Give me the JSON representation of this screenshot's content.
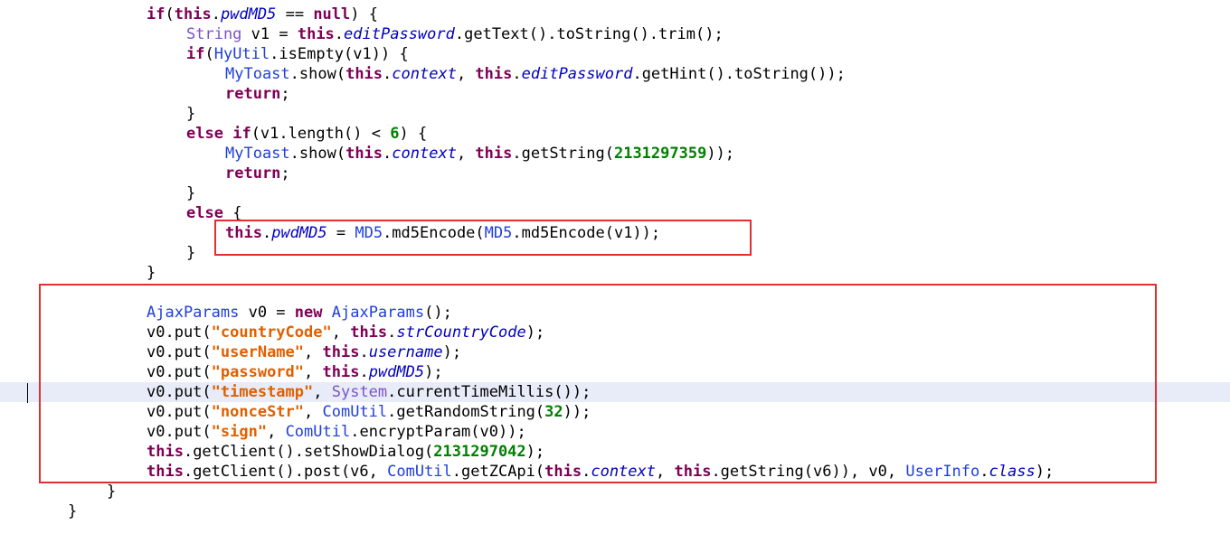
{
  "editor": {
    "lines": [
      [
        {
          "t": "if",
          "c": "kw"
        },
        {
          "t": "("
        },
        {
          "t": "this",
          "c": "kw"
        },
        {
          "t": "."
        },
        {
          "t": "pwdMD5",
          "c": "fld"
        },
        {
          "t": " == "
        },
        {
          "t": "null",
          "c": "kw"
        },
        {
          "t": ") {"
        }
      ],
      [
        {
          "t": "String",
          "c": "iface"
        },
        {
          "t": " v1 = "
        },
        {
          "t": "this",
          "c": "kw"
        },
        {
          "t": "."
        },
        {
          "t": "editPassword",
          "c": "fld"
        },
        {
          "t": ".getText().toString().trim();"
        }
      ],
      [
        {
          "t": "if",
          "c": "kw"
        },
        {
          "t": "("
        },
        {
          "t": "HyUtil",
          "c": "cls"
        },
        {
          "t": ".isEmpty(v1)) {"
        }
      ],
      [
        {
          "t": "MyToast",
          "c": "cls"
        },
        {
          "t": ".show("
        },
        {
          "t": "this",
          "c": "kw"
        },
        {
          "t": "."
        },
        {
          "t": "context",
          "c": "fld"
        },
        {
          "t": ", "
        },
        {
          "t": "this",
          "c": "kw"
        },
        {
          "t": "."
        },
        {
          "t": "editPassword",
          "c": "fld"
        },
        {
          "t": ".getHint().toString());"
        }
      ],
      [
        {
          "t": "return",
          "c": "kw"
        },
        {
          "t": ";"
        }
      ],
      [
        {
          "t": "}"
        }
      ],
      [
        {
          "t": "else",
          "c": "kw"
        },
        {
          "t": " "
        },
        {
          "t": "if",
          "c": "kw"
        },
        {
          "t": "(v1.length() < "
        },
        {
          "t": "6",
          "c": "num"
        },
        {
          "t": ") {"
        }
      ],
      [
        {
          "t": "MyToast",
          "c": "cls"
        },
        {
          "t": ".show("
        },
        {
          "t": "this",
          "c": "kw"
        },
        {
          "t": "."
        },
        {
          "t": "context",
          "c": "fld"
        },
        {
          "t": ", "
        },
        {
          "t": "this",
          "c": "kw"
        },
        {
          "t": ".getString("
        },
        {
          "t": "2131297359",
          "c": "num"
        },
        {
          "t": "));"
        }
      ],
      [
        {
          "t": "return",
          "c": "kw"
        },
        {
          "t": ";"
        }
      ],
      [
        {
          "t": "}"
        }
      ],
      [
        {
          "t": "else",
          "c": "kw"
        },
        {
          "t": " {"
        }
      ],
      [
        {
          "t": "this",
          "c": "kw"
        },
        {
          "t": "."
        },
        {
          "t": "pwdMD5",
          "c": "fld"
        },
        {
          "t": " = "
        },
        {
          "t": "MD5",
          "c": "cls"
        },
        {
          "t": ".md5Encode("
        },
        {
          "t": "MD5",
          "c": "cls"
        },
        {
          "t": ".md5Encode(v1));"
        }
      ],
      [
        {
          "t": "}"
        }
      ],
      [
        {
          "t": "}"
        }
      ],
      [],
      [
        {
          "t": "AjaxParams",
          "c": "cls"
        },
        {
          "t": " v0 = "
        },
        {
          "t": "new",
          "c": "kw"
        },
        {
          "t": " "
        },
        {
          "t": "AjaxParams",
          "c": "cls"
        },
        {
          "t": "();"
        }
      ],
      [
        {
          "t": "v0.put("
        },
        {
          "t": "\"countryCode\"",
          "c": "str"
        },
        {
          "t": ", "
        },
        {
          "t": "this",
          "c": "kw"
        },
        {
          "t": "."
        },
        {
          "t": "strCountryCode",
          "c": "fld"
        },
        {
          "t": ");"
        }
      ],
      [
        {
          "t": "v0.put("
        },
        {
          "t": "\"userName\"",
          "c": "str"
        },
        {
          "t": ", "
        },
        {
          "t": "this",
          "c": "kw"
        },
        {
          "t": "."
        },
        {
          "t": "username",
          "c": "fld"
        },
        {
          "t": ");"
        }
      ],
      [
        {
          "t": "v0.put("
        },
        {
          "t": "\"password\"",
          "c": "str"
        },
        {
          "t": ", "
        },
        {
          "t": "this",
          "c": "kw"
        },
        {
          "t": "."
        },
        {
          "t": "pwdMD5",
          "c": "fld"
        },
        {
          "t": ");"
        }
      ],
      [
        {
          "t": "v0.put("
        },
        {
          "t": "\"timestamp\"",
          "c": "str"
        },
        {
          "t": ", "
        },
        {
          "t": "System",
          "c": "iface"
        },
        {
          "t": ".currentTimeMillis());"
        }
      ],
      [
        {
          "t": "v0.put("
        },
        {
          "t": "\"nonceStr\"",
          "c": "str"
        },
        {
          "t": ", "
        },
        {
          "t": "ComUtil",
          "c": "cls"
        },
        {
          "t": ".getRandomString("
        },
        {
          "t": "32",
          "c": "num"
        },
        {
          "t": "));"
        }
      ],
      [
        {
          "t": "v0.put("
        },
        {
          "t": "\"sign\"",
          "c": "str"
        },
        {
          "t": ", "
        },
        {
          "t": "ComUtil",
          "c": "cls"
        },
        {
          "t": ".encryptParam(v0));"
        }
      ],
      [
        {
          "t": "this",
          "c": "kw"
        },
        {
          "t": ".getClient().setShowDialog("
        },
        {
          "t": "2131297042",
          "c": "num"
        },
        {
          "t": ");"
        }
      ],
      [
        {
          "t": "this",
          "c": "kw"
        },
        {
          "t": ".getClient().post(v6, "
        },
        {
          "t": "ComUtil",
          "c": "cls"
        },
        {
          "t": ".getZCApi("
        },
        {
          "t": "this",
          "c": "kw"
        },
        {
          "t": "."
        },
        {
          "t": "context",
          "c": "fld"
        },
        {
          "t": ", "
        },
        {
          "t": "this",
          "c": "kw"
        },
        {
          "t": ".getString(v6)), v0, "
        },
        {
          "t": "UserInfo",
          "c": "cls"
        },
        {
          "t": "."
        },
        {
          "t": "class",
          "c": "fld"
        },
        {
          "t": ");"
        }
      ],
      [
        {
          "t": "}"
        }
      ],
      [
        {
          "t": "}"
        }
      ]
    ]
  }
}
